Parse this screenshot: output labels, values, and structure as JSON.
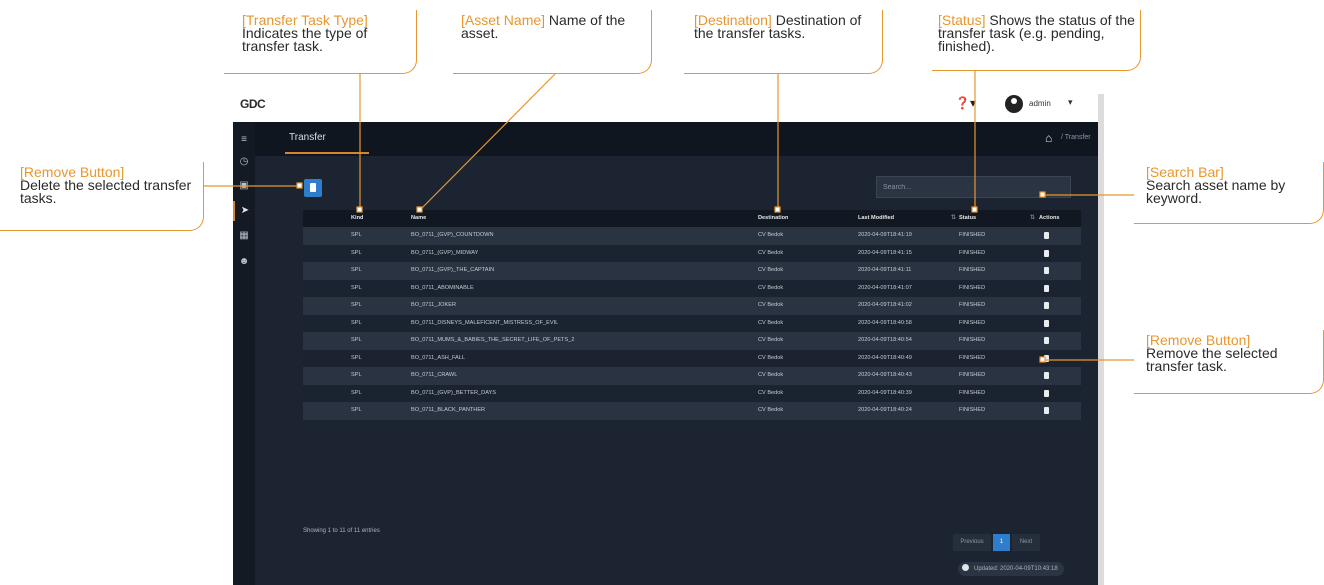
{
  "app": {
    "logo": "GDC",
    "user": "admin",
    "page_title": "Transfer",
    "breadcrumb": "/ Transfer",
    "search_placeholder": "Search...",
    "columns": [
      "Kind",
      "Name",
      "Destination",
      "Last Modified",
      "Status",
      "Actions"
    ],
    "rows": [
      {
        "kind": "SPL",
        "name": "BO_0711_(GVP)_COUNTDOWN",
        "destination": "CV Bedok",
        "last_modified": "2020-04-09T18:41:19",
        "status": "FINISHED"
      },
      {
        "kind": "SPL",
        "name": "BO_0711_(GVP)_MIDWAY",
        "destination": "CV Bedok",
        "last_modified": "2020-04-09T18:41:15",
        "status": "FINISHED"
      },
      {
        "kind": "SPL",
        "name": "BO_0711_(GVP)_THE_CAPTAIN",
        "destination": "CV Bedok",
        "last_modified": "2020-04-09T18:41:11",
        "status": "FINISHED"
      },
      {
        "kind": "SPL",
        "name": "BO_0711_ABOMINABLE",
        "destination": "CV Bedok",
        "last_modified": "2020-04-09T18:41:07",
        "status": "FINISHED"
      },
      {
        "kind": "SPL",
        "name": "BO_0711_JOKER",
        "destination": "CV Bedok",
        "last_modified": "2020-04-09T18:41:02",
        "status": "FINISHED"
      },
      {
        "kind": "SPL",
        "name": "BO_0711_DISNEYS_MALEFICENT_MISTRESS_OF_EVIL",
        "destination": "CV Bedok",
        "last_modified": "2020-04-09T18:40:58",
        "status": "FINISHED"
      },
      {
        "kind": "SPL",
        "name": "BO_0711_MUMS_&_BABIES_THE_SECRET_LIFE_OF_PETS_2",
        "destination": "CV Bedok",
        "last_modified": "2020-04-09T18:40:54",
        "status": "FINISHED"
      },
      {
        "kind": "SPL",
        "name": "BO_0711_ASH_FALL",
        "destination": "CV Bedok",
        "last_modified": "2020-04-09T18:40:49",
        "status": "FINISHED"
      },
      {
        "kind": "SPL",
        "name": "BO_0711_CRAWL",
        "destination": "CV Bedok",
        "last_modified": "2020-04-09T18:40:43",
        "status": "FINISHED"
      },
      {
        "kind": "SPL",
        "name": "BO_0711_(GVP)_BETTER_DAYS",
        "destination": "CV Bedok",
        "last_modified": "2020-04-09T18:40:39",
        "status": "FINISHED"
      },
      {
        "kind": "SPL",
        "name": "BO_0711_BLACK_PANTHER",
        "destination": "CV Bedok",
        "last_modified": "2020-04-09T18:40:24",
        "status": "FINISHED"
      }
    ],
    "entries_info": "Showing 1 to 11 of 11 entries",
    "pagination": {
      "previous": "Previous",
      "current": "1",
      "next": "Next"
    },
    "updated": "Updated: 2020-04-09T10:43:18"
  },
  "callouts": {
    "type": {
      "title": "[Transfer Task Type]",
      "desc": "Indicates the type of transfer task."
    },
    "asset": {
      "title": "[Asset Name]",
      "desc": " Name of the asset."
    },
    "destination": {
      "title": "[Destination]",
      "desc": " Destination of the transfer tasks."
    },
    "status": {
      "title": "[Status]",
      "desc": " Shows the status of the transfer task (e.g. pending, finished)."
    },
    "remove_left": {
      "title": "[Remove Button]",
      "desc": "Delete the selected transfer tasks."
    },
    "search": {
      "title": "[Search Bar]",
      "desc": "Search asset name by keyword."
    },
    "remove_right": {
      "title": "[Remove Button]",
      "desc": "Remove the selected transfer task."
    }
  },
  "colors": {
    "accent": "#e8962e",
    "app_bg": "#1c2431",
    "primary_button": "#2f7ecb"
  }
}
